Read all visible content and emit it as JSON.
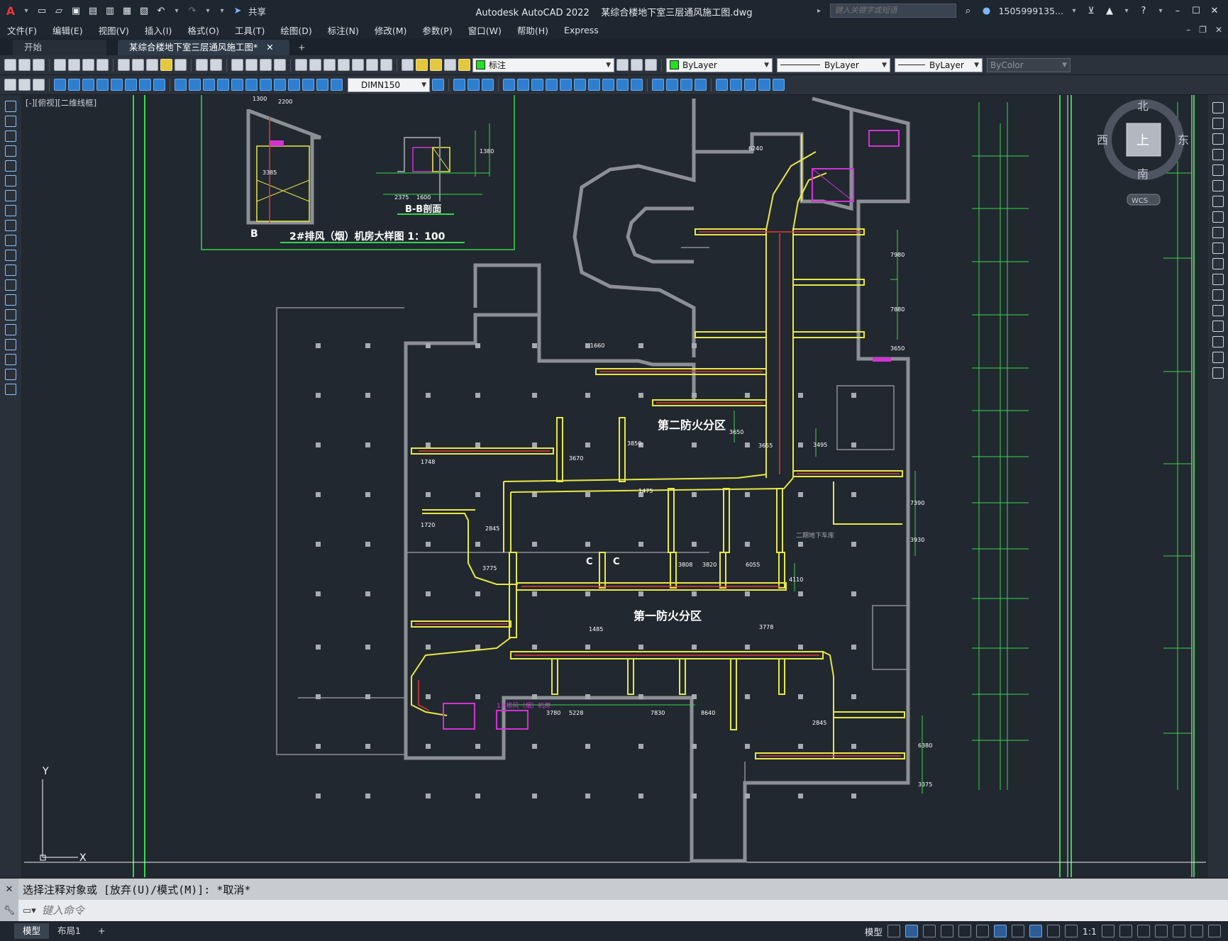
{
  "window": {
    "app_title": "Autodesk AutoCAD 2022",
    "file_title": "某综合楼地下室三层通风施工图.dwg",
    "share_label": "共享",
    "search_placeholder": "键入关键字或短语",
    "user": "1505999135..."
  },
  "menu": [
    "文件(F)",
    "编辑(E)",
    "视图(V)",
    "插入(I)",
    "格式(O)",
    "工具(T)",
    "绘图(D)",
    "标注(N)",
    "修改(M)",
    "参数(P)",
    "窗口(W)",
    "帮助(H)",
    "Express"
  ],
  "tabs": [
    {
      "label": "开始"
    },
    {
      "label": "某综合楼地下室三层通风施工图*"
    }
  ],
  "toolbar": {
    "layer_value": "标注",
    "color_value": "ByLayer",
    "linetype_value": "ByLayer",
    "lineweight_value": "ByLayer",
    "plotstyle_value": "ByColor",
    "dimstyle_value": "DIMN150"
  },
  "viewport": {
    "label": "[-][俯视][二维线框]",
    "viewcube_top": "上",
    "compass": {
      "n": "北",
      "s": "南",
      "e": "东",
      "w": "西"
    },
    "ucs": "WCS",
    "axis_x": "X",
    "axis_y": "Y"
  },
  "drawing": {
    "detail_title": "2#排风（烟）机房大样图  1：100",
    "section_label": "B-B剖面",
    "zone2": "第二防火分区",
    "zone1": "第一防火分区",
    "room_label": "1#排风（烟）机房",
    "garage_label": "二期地下车库",
    "dims_detail": [
      "1300",
      "2200",
      "3385",
      "2375",
      "1600",
      "1380"
    ],
    "dims_plan": [
      "6240",
      "1660",
      "1748",
      "3670",
      "3850",
      "1720",
      "2845",
      "1475",
      "3808",
      "3820",
      "6055",
      "3775",
      "1485",
      "3778",
      "3780",
      "7830",
      "5228",
      "8640",
      "7980",
      "7880",
      "3650",
      "7390",
      "3930",
      "4110",
      "3650",
      "3655",
      "3495",
      "2845",
      "6380",
      "3375"
    ],
    "markers": [
      "C",
      "C"
    ],
    "colors": {
      "duct": "#e8e845",
      "dim": "#39d64a",
      "wall": "#8c9096",
      "red": "#e53935",
      "magenta": "#d233d2"
    }
  },
  "command": {
    "history": "选择注释对象或 [放弃(U)/模式(M)]: *取消*",
    "placeholder": "键入命令"
  },
  "status": {
    "layout_tabs": [
      "模型",
      "布局1"
    ],
    "model_label": "模型",
    "scale": "1:1"
  }
}
